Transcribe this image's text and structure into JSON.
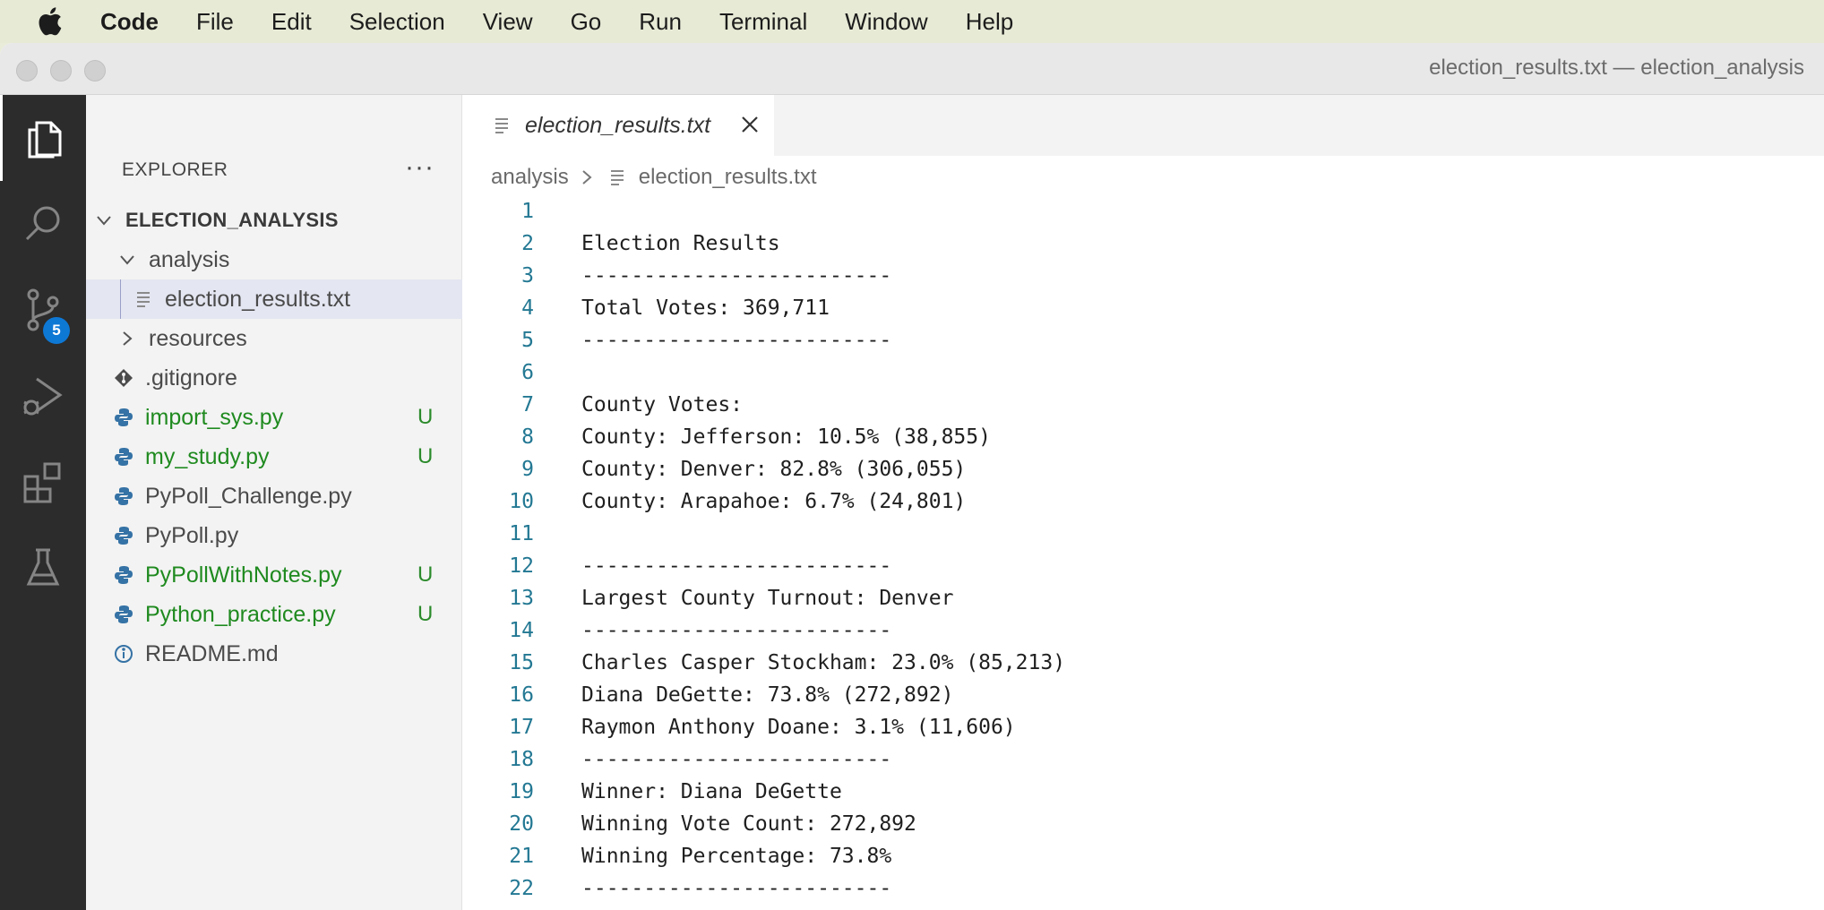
{
  "menubar": {
    "app": "Code",
    "items": [
      "File",
      "Edit",
      "Selection",
      "View",
      "Go",
      "Run",
      "Terminal",
      "Window",
      "Help"
    ]
  },
  "window": {
    "title": "election_results.txt — election_analysis"
  },
  "activitybar": {
    "icons": [
      "explorer-icon",
      "search-icon",
      "source-control-icon",
      "run-debug-icon",
      "extensions-icon",
      "testing-icon"
    ],
    "source_control_badge": "5"
  },
  "sidebar": {
    "header": "EXPLORER",
    "more": "···",
    "root": "ELECTION_ANALYSIS",
    "folder_analysis": "analysis",
    "selected_file": "election_results.txt",
    "folder_resources": "resources",
    "files": [
      {
        "name": ".gitignore",
        "status": ""
      },
      {
        "name": "import_sys.py",
        "status": "U"
      },
      {
        "name": "my_study.py",
        "status": "U"
      },
      {
        "name": "PyPoll_Challenge.py",
        "status": ""
      },
      {
        "name": "PyPoll.py",
        "status": ""
      },
      {
        "name": "PyPollWithNotes.py",
        "status": "U"
      },
      {
        "name": "Python_practice.py",
        "status": "U"
      },
      {
        "name": "README.md",
        "status": ""
      }
    ]
  },
  "editor": {
    "tab_label": "election_results.txt",
    "breadcrumb": {
      "folder": "analysis",
      "file": "election_results.txt"
    },
    "lines": [
      "",
      "Election Results",
      "-------------------------",
      "Total Votes: 369,711",
      "-------------------------",
      "",
      "County Votes:",
      "County: Jefferson: 10.5% (38,855)",
      "County: Denver: 82.8% (306,055)",
      "County: Arapahoe: 6.7% (24,801)",
      "",
      "-------------------------",
      "Largest County Turnout: Denver",
      "-------------------------",
      "Charles Casper Stockham: 23.0% (85,213)",
      "Diana DeGette: 73.8% (272,892)",
      "Raymon Anthony Doane: 3.1% (11,606)",
      "-------------------------",
      "Winner: Diana DeGette",
      "Winning Vote Count: 272,892",
      "Winning Percentage: 73.8%",
      "-------------------------"
    ]
  },
  "colors": {
    "line_number": "#237893",
    "untracked_file": "#1f8a1f",
    "badge": "#0e78d5",
    "activity_bar": "#2c2c2c"
  }
}
